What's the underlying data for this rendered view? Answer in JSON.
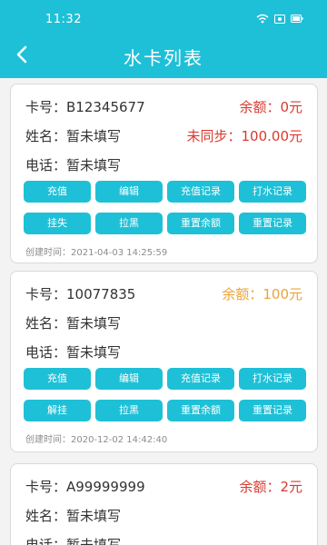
{
  "status_bar": {
    "time": "11:32",
    "icons": [
      "wifi-icon",
      "sim-icon",
      "battery-icon"
    ]
  },
  "header": {
    "title": "水卡列表",
    "back_icon": "chevron-left-icon",
    "background": "#1ec0d7"
  },
  "colors": {
    "accent": "#1ec0d7",
    "balance_red": "#d83a2f",
    "balance_orange": "#eba33a"
  },
  "cards": [
    {
      "card_no": "卡号：B12345677",
      "balance": "余额：0元",
      "name": "姓名：暂未填写",
      "unsynced": "未同步：100.00元",
      "phone": "电话：暂未填写",
      "buttons_row1": [
        "充值",
        "编辑",
        "充值记录",
        "打水记录"
      ],
      "buttons_row2": [
        "挂失",
        "拉黑",
        "重置余额",
        "重置记录"
      ],
      "created": "创建时间：2021-04-03 14:25:59"
    },
    {
      "card_no": "卡号：10077835",
      "balance": "余额：100元",
      "name": "姓名：暂未填写",
      "phone": "电话：暂未填写",
      "buttons_row1": [
        "充值",
        "编辑",
        "充值记录",
        "打水记录"
      ],
      "buttons_row2": [
        "解挂",
        "拉黑",
        "重置余额",
        "重置记录"
      ],
      "created": "创建时间：2020-12-02 14:42:40"
    },
    {
      "card_no": "卡号：A99999999",
      "balance": "余额：2元",
      "name": "姓名：暂未填写",
      "phone": "电话：暂未填写"
    }
  ]
}
